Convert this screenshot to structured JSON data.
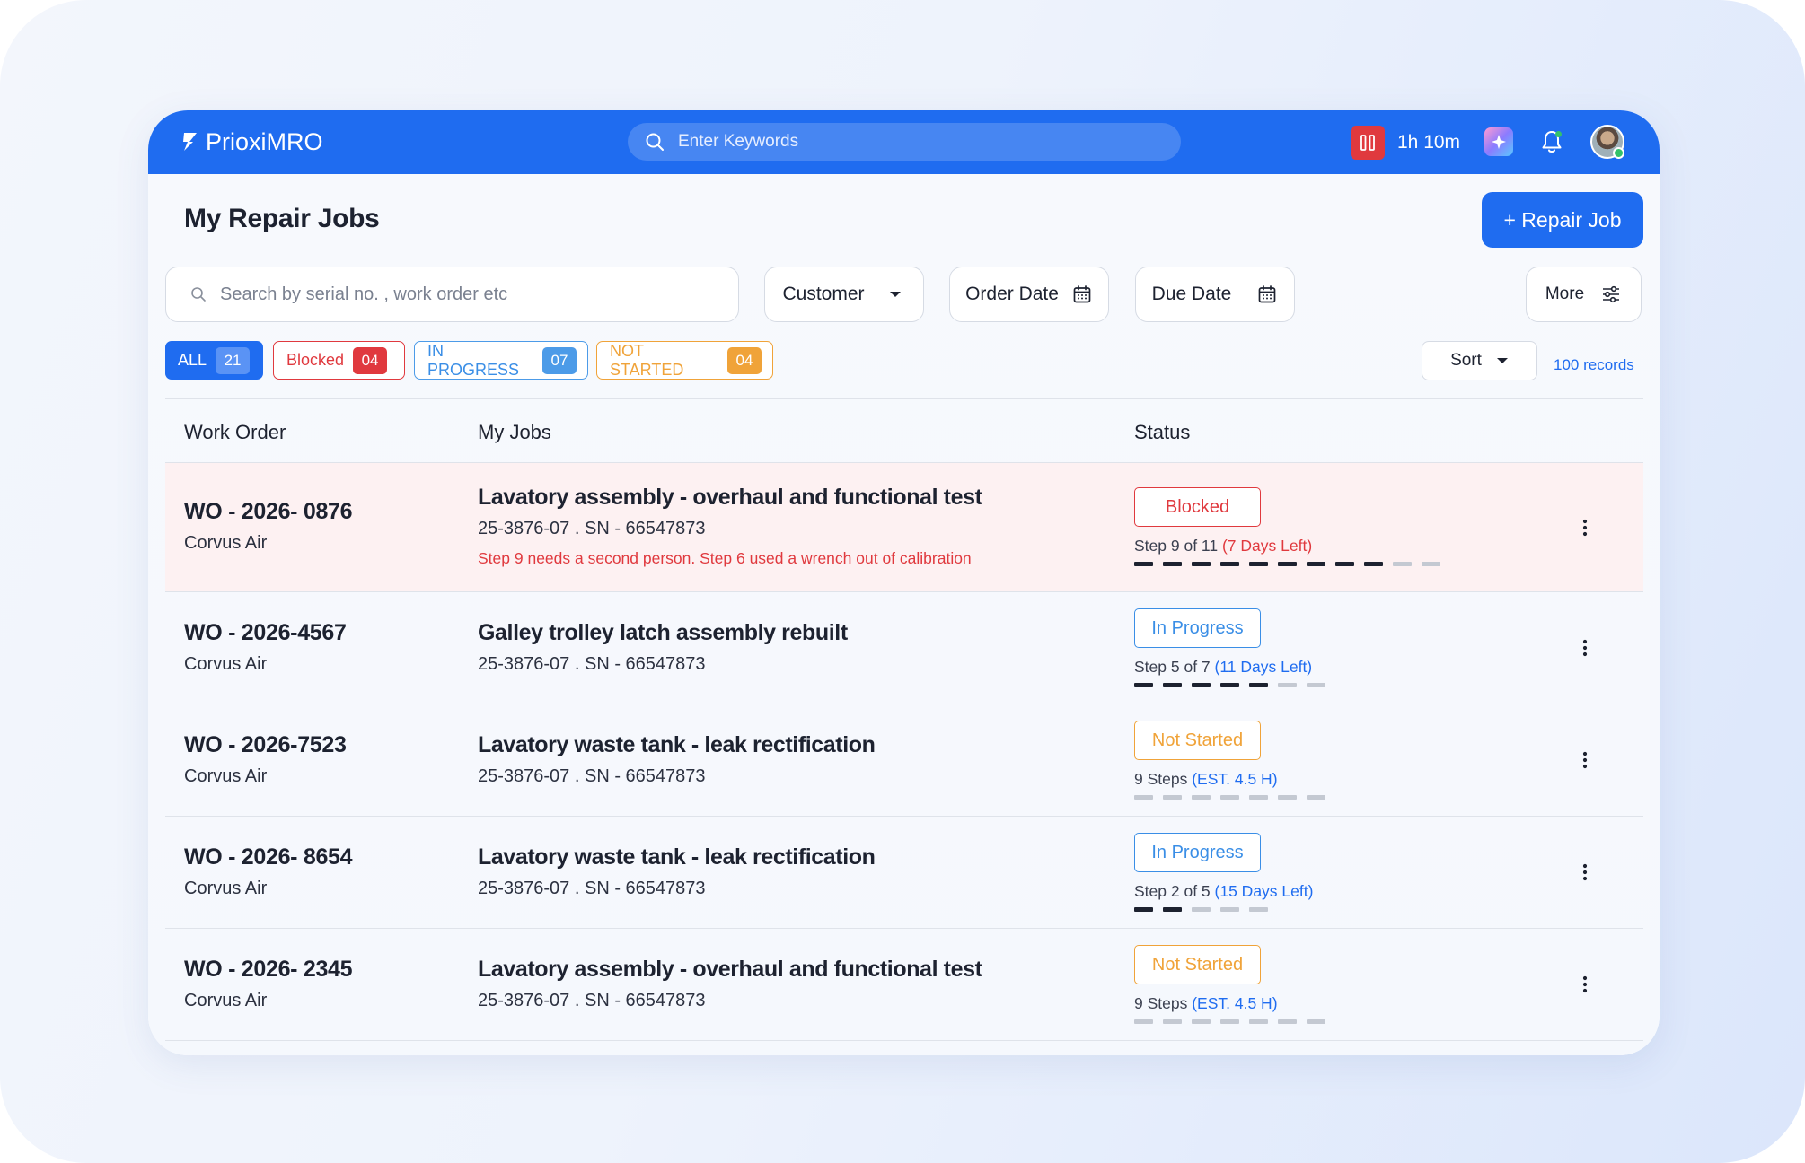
{
  "app": {
    "name": "PrioxiMRO"
  },
  "topbar": {
    "search_placeholder": "Enter Keywords",
    "timer": "1h 10m",
    "icons": {
      "pause": "pause-icon",
      "ai": "sparkle-icon",
      "notifications": "bell-icon",
      "avatar": "avatar"
    }
  },
  "page": {
    "title": "My Repair Jobs",
    "add_button": "+ Repair Job"
  },
  "filters": {
    "search_placeholder": "Search by serial no. , work order etc",
    "customer": "Customer",
    "order_date": "Order Date",
    "due_date": "Due Date",
    "more": "More"
  },
  "chips": [
    {
      "label": "ALL",
      "count": "21",
      "color": "#1f6cf0"
    },
    {
      "label": "Blocked",
      "count": "04",
      "color": "#e0393e"
    },
    {
      "label": "IN PROGRESS",
      "count": "07",
      "color": "#4c9be8"
    },
    {
      "label": "NOT STARTED",
      "count": "04",
      "color": "#f0a339"
    }
  ],
  "sort": {
    "label": "Sort"
  },
  "records": "100 records",
  "table": {
    "headers": {
      "work_order": "Work Order",
      "my_jobs": "My Jobs",
      "status": "Status"
    },
    "rows": [
      {
        "wo": "WO - 2026- 0876",
        "customer": "Corvus Air",
        "job": "Lavatory assembly - overhaul and functional test",
        "sn": "25-3876-07 .  SN - 66547873",
        "note": "Step 9 needs a second person. Step 6 used a wrench out of calibration",
        "status": "Blocked",
        "status_type": "blocked",
        "step_text": "Step 9 of 11",
        "step_hint": "(7 Days Left)",
        "hint_color": "red",
        "progress_done": 9,
        "progress_total": 11
      },
      {
        "wo": "WO - 2026-4567",
        "customer": "Corvus Air",
        "job": "Galley trolley latch assembly rebuilt",
        "sn": "25-3876-07 .  SN - 66547873",
        "note": "",
        "status": "In Progress",
        "status_type": "progress",
        "step_text": "Step 5 of 7",
        "step_hint": "(11 Days Left)",
        "hint_color": "blue",
        "progress_done": 5,
        "progress_total": 7
      },
      {
        "wo": "WO - 2026-7523",
        "customer": "Corvus Air",
        "job": "Lavatory waste tank - leak rectification",
        "sn": "25-3876-07 .  SN - 66547873",
        "note": "",
        "status": "Not Started",
        "status_type": "notstarted",
        "step_text": "9 Steps",
        "step_hint": " (EST. 4.5 H)",
        "hint_color": "blue",
        "progress_done": 0,
        "progress_total": 7
      },
      {
        "wo": "WO - 2026- 8654",
        "customer": "Corvus Air",
        "job": "Lavatory waste tank - leak rectification",
        "sn": "25-3876-07 .  SN - 66547873",
        "note": "",
        "status": "In Progress",
        "status_type": "progress",
        "step_text": "Step 2 of 5",
        "step_hint": "(15 Days Left)",
        "hint_color": "blue",
        "progress_done": 2,
        "progress_total": 5
      },
      {
        "wo": "WO - 2026- 2345",
        "customer": "Corvus Air",
        "job": "Lavatory assembly - overhaul and functional test",
        "sn": "25-3876-07 .  SN - 66547873",
        "note": "",
        "status": "Not Started",
        "status_type": "notstarted",
        "step_text": "9 Steps",
        "step_hint": " (EST. 4.5 H)",
        "hint_color": "blue",
        "progress_done": 0,
        "progress_total": 7
      }
    ]
  }
}
